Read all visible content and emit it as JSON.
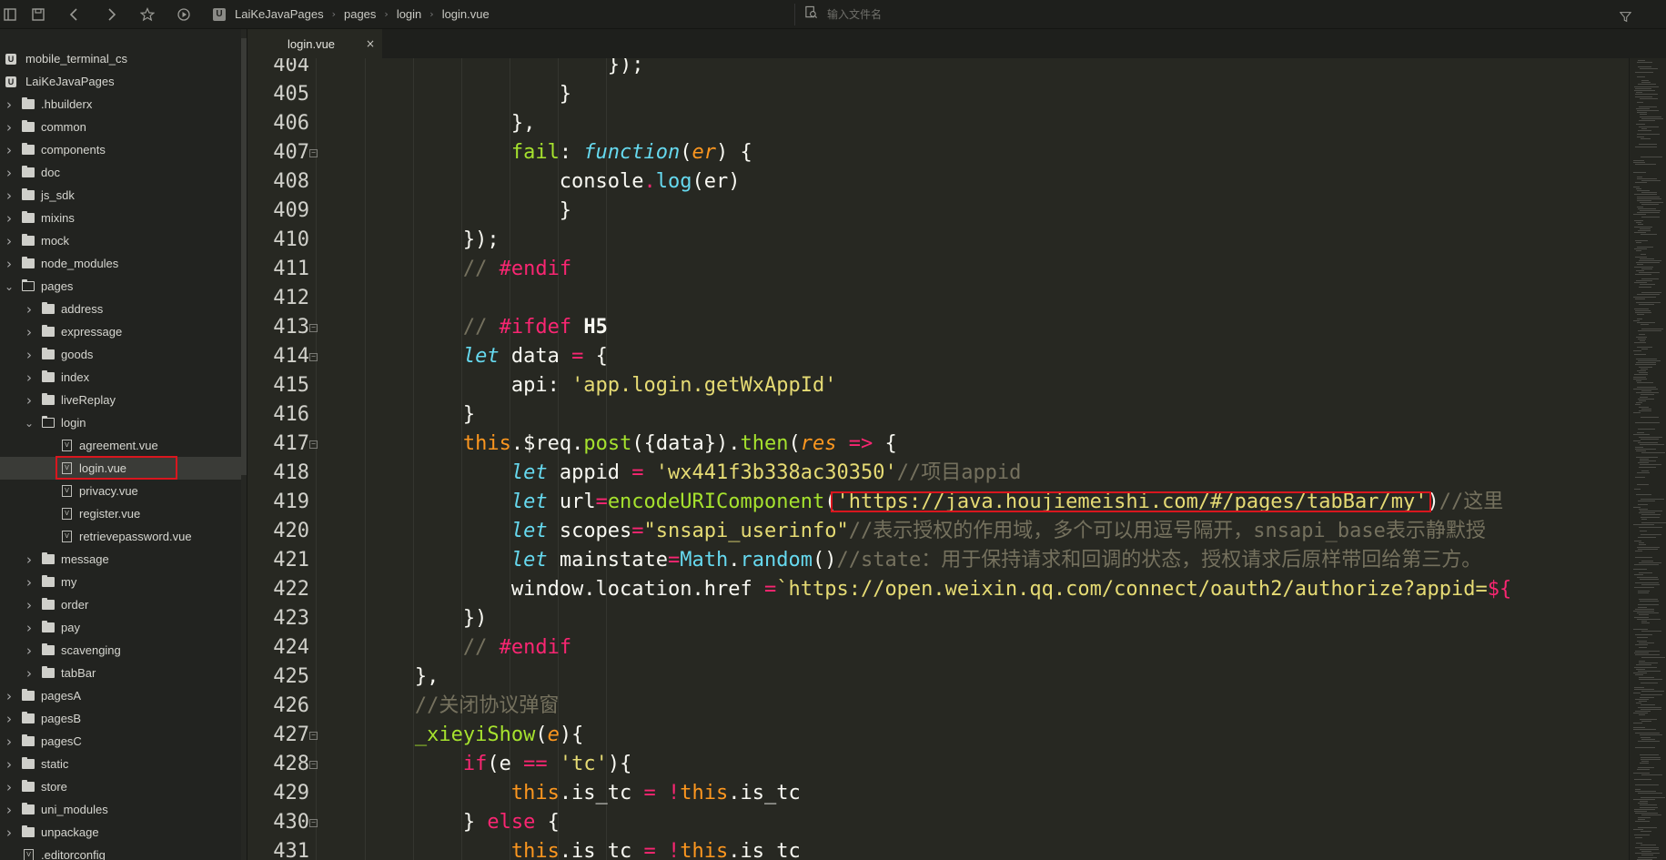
{
  "toolbar": {
    "breadcrumb": [
      "LaiKeJavaPages",
      "pages",
      "login",
      "login.vue"
    ],
    "search_placeholder": "输入文件名"
  },
  "sidebar": {
    "projects": [
      "mobile_terminal_cs",
      "LaiKeJavaPages"
    ],
    "items": [
      {
        "label": ".hbuilderx",
        "depth": 1,
        "type": "folder",
        "open": false
      },
      {
        "label": "common",
        "depth": 1,
        "type": "folder",
        "open": false
      },
      {
        "label": "components",
        "depth": 1,
        "type": "folder",
        "open": false
      },
      {
        "label": "doc",
        "depth": 1,
        "type": "folder",
        "open": false
      },
      {
        "label": "js_sdk",
        "depth": 1,
        "type": "folder",
        "open": false
      },
      {
        "label": "mixins",
        "depth": 1,
        "type": "folder",
        "open": false
      },
      {
        "label": "mock",
        "depth": 1,
        "type": "folder",
        "open": false
      },
      {
        "label": "node_modules",
        "depth": 1,
        "type": "folder",
        "open": false
      },
      {
        "label": "pages",
        "depth": 1,
        "type": "folder",
        "open": true
      },
      {
        "label": "address",
        "depth": 2,
        "type": "folder",
        "open": false
      },
      {
        "label": "expressage",
        "depth": 2,
        "type": "folder",
        "open": false
      },
      {
        "label": "goods",
        "depth": 2,
        "type": "folder",
        "open": false
      },
      {
        "label": "index",
        "depth": 2,
        "type": "folder",
        "open": false
      },
      {
        "label": "liveReplay",
        "depth": 2,
        "type": "folder",
        "open": false
      },
      {
        "label": "login",
        "depth": 2,
        "type": "folder",
        "open": true
      },
      {
        "label": "agreement.vue",
        "depth": 3,
        "type": "file"
      },
      {
        "label": "login.vue",
        "depth": 3,
        "type": "file",
        "selected": true
      },
      {
        "label": "privacy.vue",
        "depth": 3,
        "type": "file"
      },
      {
        "label": "register.vue",
        "depth": 3,
        "type": "file"
      },
      {
        "label": "retrievepassword.vue",
        "depth": 3,
        "type": "file"
      },
      {
        "label": "message",
        "depth": 2,
        "type": "folder",
        "open": false
      },
      {
        "label": "my",
        "depth": 2,
        "type": "folder",
        "open": false
      },
      {
        "label": "order",
        "depth": 2,
        "type": "folder",
        "open": false
      },
      {
        "label": "pay",
        "depth": 2,
        "type": "folder",
        "open": false
      },
      {
        "label": "scavenging",
        "depth": 2,
        "type": "folder",
        "open": false
      },
      {
        "label": "tabBar",
        "depth": 2,
        "type": "folder",
        "open": false
      },
      {
        "label": "pagesA",
        "depth": 1,
        "type": "folder",
        "open": false
      },
      {
        "label": "pagesB",
        "depth": 1,
        "type": "folder",
        "open": false
      },
      {
        "label": "pagesC",
        "depth": 1,
        "type": "folder",
        "open": false
      },
      {
        "label": "static",
        "depth": 1,
        "type": "folder",
        "open": false
      },
      {
        "label": "store",
        "depth": 1,
        "type": "folder",
        "open": false
      },
      {
        "label": "uni_modules",
        "depth": 1,
        "type": "folder",
        "open": false
      },
      {
        "label": "unpackage",
        "depth": 1,
        "type": "folder",
        "open": false
      },
      {
        "label": ".editorconfig",
        "depth": 1,
        "type": "file"
      }
    ]
  },
  "tab": {
    "label": "login.vue",
    "close": "×"
  },
  "editor": {
    "lines": [
      {
        "n": "404",
        "fold": false,
        "indent": 6,
        "tokens": [
          [
            "",
            "});"
          ]
        ]
      },
      {
        "n": "405",
        "fold": false,
        "indent": 5,
        "tokens": [
          [
            "",
            "}"
          ]
        ]
      },
      {
        "n": "406",
        "fold": false,
        "indent": 4,
        "tokens": [
          [
            "",
            "},"
          ]
        ]
      },
      {
        "n": "407",
        "fold": true,
        "indent": 4,
        "tokens": [
          [
            "fn",
            "fail"
          ],
          [
            "",
            ": "
          ],
          [
            "it",
            "function"
          ],
          [
            "",
            "("
          ],
          [
            "prm",
            "er"
          ],
          [
            "",
            ") {"
          ]
        ]
      },
      {
        "n": "408",
        "fold": false,
        "indent": 5,
        "tokens": [
          [
            "",
            "console"
          ],
          [
            "kw",
            "."
          ],
          [
            "cyan",
            "log"
          ],
          [
            "",
            "(er)"
          ]
        ]
      },
      {
        "n": "409",
        "fold": false,
        "indent": 5,
        "tokens": [
          [
            "",
            "}"
          ]
        ]
      },
      {
        "n": "410",
        "fold": false,
        "indent": 3,
        "tokens": [
          [
            "",
            "});"
          ]
        ]
      },
      {
        "n": "411",
        "fold": false,
        "indent": 3,
        "tokens": [
          [
            "cmt",
            "// "
          ],
          [
            "kw",
            "#endif"
          ]
        ]
      },
      {
        "n": "412",
        "fold": false,
        "indent": 0,
        "tokens": []
      },
      {
        "n": "413",
        "fold": true,
        "indent": 3,
        "tokens": [
          [
            "cmt",
            "// "
          ],
          [
            "kw",
            "#ifdef "
          ],
          [
            "bold",
            "H5"
          ]
        ]
      },
      {
        "n": "414",
        "fold": true,
        "indent": 3,
        "tokens": [
          [
            "it",
            "let"
          ],
          [
            "",
            " data "
          ],
          [
            "kw",
            "="
          ],
          [
            "",
            " {"
          ]
        ]
      },
      {
        "n": "415",
        "fold": false,
        "indent": 4,
        "tokens": [
          [
            "",
            "api: "
          ],
          [
            "str",
            "'app.login.getWxAppId'"
          ]
        ]
      },
      {
        "n": "416",
        "fold": false,
        "indent": 3,
        "tokens": [
          [
            "",
            "}"
          ]
        ]
      },
      {
        "n": "417",
        "fold": true,
        "indent": 3,
        "tokens": [
          [
            "this",
            "this"
          ],
          [
            "",
            ".$req."
          ],
          [
            "fn",
            "post"
          ],
          [
            "",
            "({data})."
          ],
          [
            "fn",
            "then"
          ],
          [
            "",
            "("
          ],
          [
            "prm",
            "res"
          ],
          [
            "",
            " "
          ],
          [
            "kw",
            "=>"
          ],
          [
            "",
            " {"
          ]
        ]
      },
      {
        "n": "418",
        "fold": false,
        "indent": 4,
        "tokens": [
          [
            "it",
            "let"
          ],
          [
            "",
            " appid "
          ],
          [
            "kw",
            "="
          ],
          [
            "",
            " "
          ],
          [
            "str",
            "'wx441f3b338ac30350'"
          ],
          [
            "cmt",
            "//项目appid"
          ]
        ]
      },
      {
        "n": "419",
        "fold": false,
        "indent": 4,
        "tokens": [
          [
            "it",
            "let"
          ],
          [
            "",
            " url"
          ],
          [
            "kw",
            "="
          ],
          [
            "fn",
            "encodeURIComponent"
          ],
          [
            "",
            "("
          ],
          [
            "str",
            "'https://java.houjiemeishi.com/#/pages/tabBar/my'"
          ],
          [
            "",
            ")"
          ],
          [
            "cmt",
            "//这里"
          ]
        ]
      },
      {
        "n": "420",
        "fold": false,
        "indent": 4,
        "tokens": [
          [
            "it",
            "let"
          ],
          [
            "",
            " scopes"
          ],
          [
            "kw",
            "="
          ],
          [
            "str",
            "\"snsapi_userinfo\""
          ],
          [
            "cmt",
            "//表示授权的作用域，多个可以用逗号隔开，snsapi_base表示静默授"
          ]
        ]
      },
      {
        "n": "421",
        "fold": false,
        "indent": 4,
        "tokens": [
          [
            "it",
            "let"
          ],
          [
            "",
            " mainstate"
          ],
          [
            "kw",
            "="
          ],
          [
            "cyan",
            "Math"
          ],
          [
            "",
            "."
          ],
          [
            "cyan",
            "random"
          ],
          [
            "",
            "()"
          ],
          [
            "cmt",
            "//state：用于保持请求和回调的状态，授权请求后原样带回给第三方。"
          ]
        ]
      },
      {
        "n": "422",
        "fold": false,
        "indent": 4,
        "tokens": [
          [
            "",
            "window.location.href "
          ],
          [
            "kw",
            "="
          ],
          [
            "str",
            "`https://open.weixin.qq.com/connect/oauth2/authorize?appid="
          ],
          [
            "kw",
            "${"
          ]
        ]
      },
      {
        "n": "423",
        "fold": false,
        "indent": 3,
        "tokens": [
          [
            "",
            "})"
          ]
        ]
      },
      {
        "n": "424",
        "fold": false,
        "indent": 3,
        "tokens": [
          [
            "cmt",
            "// "
          ],
          [
            "kw",
            "#endif"
          ]
        ]
      },
      {
        "n": "425",
        "fold": false,
        "indent": 2,
        "tokens": [
          [
            "",
            "},"
          ]
        ]
      },
      {
        "n": "426",
        "fold": false,
        "indent": 2,
        "tokens": [
          [
            "cmt",
            "//关闭协议弹窗"
          ]
        ]
      },
      {
        "n": "427",
        "fold": true,
        "indent": 2,
        "tokens": [
          [
            "fn",
            "_xieyiShow"
          ],
          [
            "",
            "("
          ],
          [
            "prm",
            "e"
          ],
          [
            "",
            "){"
          ]
        ]
      },
      {
        "n": "428",
        "fold": true,
        "indent": 3,
        "tokens": [
          [
            "kw",
            "if"
          ],
          [
            "",
            "(e "
          ],
          [
            "kw",
            "=="
          ],
          [
            "",
            " "
          ],
          [
            "str",
            "'tc'"
          ],
          [
            "",
            "){"
          ]
        ]
      },
      {
        "n": "429",
        "fold": false,
        "indent": 4,
        "tokens": [
          [
            "this",
            "this"
          ],
          [
            "",
            ".is_tc "
          ],
          [
            "kw",
            "="
          ],
          [
            "",
            " "
          ],
          [
            "kw",
            "!"
          ],
          [
            "this",
            "this"
          ],
          [
            "",
            ".is_tc"
          ]
        ]
      },
      {
        "n": "430",
        "fold": true,
        "indent": 3,
        "tokens": [
          [
            "",
            "} "
          ],
          [
            "kw",
            "else"
          ],
          [
            "",
            " {"
          ]
        ]
      },
      {
        "n": "431",
        "fold": false,
        "indent": 4,
        "tokens": [
          [
            "this",
            "this"
          ],
          [
            "",
            ".is_tc "
          ],
          [
            "kw",
            "="
          ],
          [
            "",
            " "
          ],
          [
            "kw",
            "!"
          ],
          [
            "this",
            "this"
          ],
          [
            "",
            ".is_tc"
          ]
        ]
      }
    ]
  }
}
